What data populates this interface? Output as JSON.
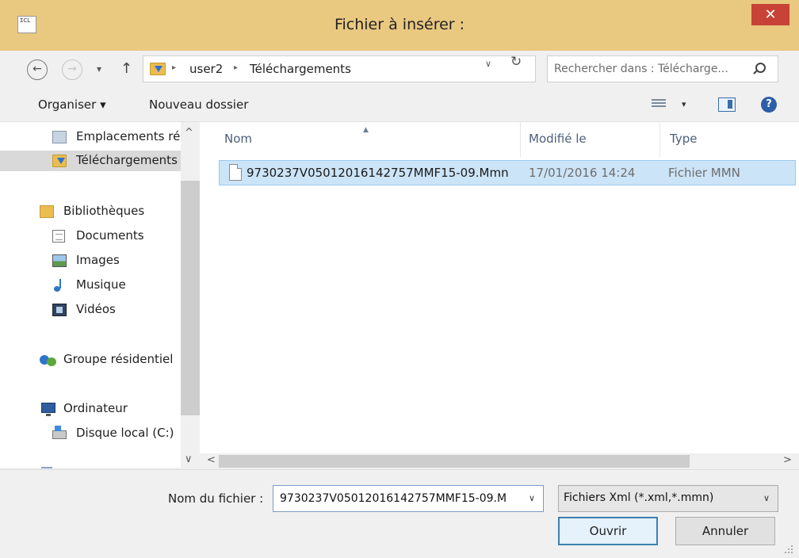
{
  "window": {
    "title": "Fichier à insérer :",
    "app_icon_text": "ΣCL",
    "close_glyph": "✕"
  },
  "nav": {
    "back_glyph": "←",
    "forward_glyph": "→",
    "recent_glyph": "▾",
    "up_glyph": "↑"
  },
  "address": {
    "breadcrumb": [
      "user2",
      "Téléchargements"
    ],
    "separator": "▸",
    "dropdown_glyph": "∨",
    "refresh_glyph": "↻"
  },
  "search": {
    "placeholder": "Rechercher dans : Télécharge..."
  },
  "toolbar": {
    "organize_label": "Organiser ▾",
    "new_folder_label": "Nouveau dossier",
    "view_dropdown_glyph": "▾",
    "help_glyph": "?"
  },
  "sidebar": {
    "items": [
      {
        "label": "Emplacements ré",
        "icon": "recent-places-icon"
      },
      {
        "label": "Téléchargements",
        "icon": "downloads-folder-icon"
      },
      {
        "label": "Bibliothèques",
        "icon": "libraries-icon"
      },
      {
        "label": "Documents",
        "icon": "documents-icon"
      },
      {
        "label": "Images",
        "icon": "pictures-icon"
      },
      {
        "label": "Musique",
        "icon": "music-icon"
      },
      {
        "label": "Vidéos",
        "icon": "videos-icon"
      },
      {
        "label": "Groupe résidentiel",
        "icon": "homegroup-icon"
      },
      {
        "label": "Ordinateur",
        "icon": "computer-icon"
      },
      {
        "label": "Disque local (C:)",
        "icon": "local-disk-icon"
      }
    ],
    "selected": "Téléchargements",
    "scroll_up_glyph": "^",
    "scroll_down_glyph": "∨"
  },
  "file_list": {
    "columns": [
      "Nom",
      "Modifié le",
      "Type"
    ],
    "sort_glyph": "▲",
    "rows": [
      {
        "name": "9730237V05012016142757MMF15-09.Mmn",
        "modified": "17/01/2016 14:24",
        "type": "Fichier MMN"
      }
    ],
    "hscroll_left_glyph": "<",
    "hscroll_right_glyph": ">"
  },
  "bottom": {
    "filename_label": "Nom du fichier :",
    "filename_value": "9730237V05012016142757MMF15-09.M",
    "filetype_label": "Fichiers Xml (*.xml,*.mmn)",
    "dropdown_glyph": "∨",
    "open_label": "Ouvrir",
    "cancel_label": "Annuler"
  },
  "colors": {
    "titlebar": "#e9c880",
    "close_button": "#c84237",
    "selection": "#cce4f7",
    "accent": "#3c7fb1"
  }
}
